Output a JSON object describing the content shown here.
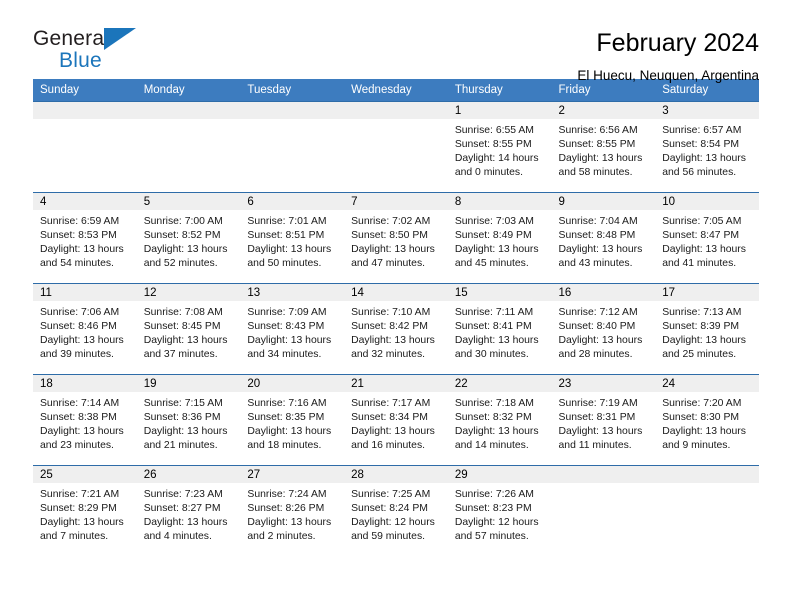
{
  "brand": {
    "name_top": "General",
    "name_bottom": "Blue"
  },
  "header": {
    "title": "February 2024",
    "subtitle": "El Huecu, Neuquen, Argentina"
  },
  "weekday_headers": [
    "Sunday",
    "Monday",
    "Tuesday",
    "Wednesday",
    "Thursday",
    "Friday",
    "Saturday"
  ],
  "colors": {
    "header_blue": "#3d7cbf",
    "row_border": "#2e6ca8",
    "daynum_band": "#efefef",
    "brand_blue": "#1b75bb"
  },
  "weeks": [
    [
      {
        "day": "",
        "empty": true
      },
      {
        "day": "",
        "empty": true
      },
      {
        "day": "",
        "empty": true
      },
      {
        "day": "",
        "empty": true
      },
      {
        "day": "1",
        "sunrise": "Sunrise: 6:55 AM",
        "sunset": "Sunset: 8:55 PM",
        "daylight1": "Daylight: 14 hours",
        "daylight2": "and 0 minutes."
      },
      {
        "day": "2",
        "sunrise": "Sunrise: 6:56 AM",
        "sunset": "Sunset: 8:55 PM",
        "daylight1": "Daylight: 13 hours",
        "daylight2": "and 58 minutes."
      },
      {
        "day": "3",
        "sunrise": "Sunrise: 6:57 AM",
        "sunset": "Sunset: 8:54 PM",
        "daylight1": "Daylight: 13 hours",
        "daylight2": "and 56 minutes."
      }
    ],
    [
      {
        "day": "4",
        "sunrise": "Sunrise: 6:59 AM",
        "sunset": "Sunset: 8:53 PM",
        "daylight1": "Daylight: 13 hours",
        "daylight2": "and 54 minutes."
      },
      {
        "day": "5",
        "sunrise": "Sunrise: 7:00 AM",
        "sunset": "Sunset: 8:52 PM",
        "daylight1": "Daylight: 13 hours",
        "daylight2": "and 52 minutes."
      },
      {
        "day": "6",
        "sunrise": "Sunrise: 7:01 AM",
        "sunset": "Sunset: 8:51 PM",
        "daylight1": "Daylight: 13 hours",
        "daylight2": "and 50 minutes."
      },
      {
        "day": "7",
        "sunrise": "Sunrise: 7:02 AM",
        "sunset": "Sunset: 8:50 PM",
        "daylight1": "Daylight: 13 hours",
        "daylight2": "and 47 minutes."
      },
      {
        "day": "8",
        "sunrise": "Sunrise: 7:03 AM",
        "sunset": "Sunset: 8:49 PM",
        "daylight1": "Daylight: 13 hours",
        "daylight2": "and 45 minutes."
      },
      {
        "day": "9",
        "sunrise": "Sunrise: 7:04 AM",
        "sunset": "Sunset: 8:48 PM",
        "daylight1": "Daylight: 13 hours",
        "daylight2": "and 43 minutes."
      },
      {
        "day": "10",
        "sunrise": "Sunrise: 7:05 AM",
        "sunset": "Sunset: 8:47 PM",
        "daylight1": "Daylight: 13 hours",
        "daylight2": "and 41 minutes."
      }
    ],
    [
      {
        "day": "11",
        "sunrise": "Sunrise: 7:06 AM",
        "sunset": "Sunset: 8:46 PM",
        "daylight1": "Daylight: 13 hours",
        "daylight2": "and 39 minutes."
      },
      {
        "day": "12",
        "sunrise": "Sunrise: 7:08 AM",
        "sunset": "Sunset: 8:45 PM",
        "daylight1": "Daylight: 13 hours",
        "daylight2": "and 37 minutes."
      },
      {
        "day": "13",
        "sunrise": "Sunrise: 7:09 AM",
        "sunset": "Sunset: 8:43 PM",
        "daylight1": "Daylight: 13 hours",
        "daylight2": "and 34 minutes."
      },
      {
        "day": "14",
        "sunrise": "Sunrise: 7:10 AM",
        "sunset": "Sunset: 8:42 PM",
        "daylight1": "Daylight: 13 hours",
        "daylight2": "and 32 minutes."
      },
      {
        "day": "15",
        "sunrise": "Sunrise: 7:11 AM",
        "sunset": "Sunset: 8:41 PM",
        "daylight1": "Daylight: 13 hours",
        "daylight2": "and 30 minutes."
      },
      {
        "day": "16",
        "sunrise": "Sunrise: 7:12 AM",
        "sunset": "Sunset: 8:40 PM",
        "daylight1": "Daylight: 13 hours",
        "daylight2": "and 28 minutes."
      },
      {
        "day": "17",
        "sunrise": "Sunrise: 7:13 AM",
        "sunset": "Sunset: 8:39 PM",
        "daylight1": "Daylight: 13 hours",
        "daylight2": "and 25 minutes."
      }
    ],
    [
      {
        "day": "18",
        "sunrise": "Sunrise: 7:14 AM",
        "sunset": "Sunset: 8:38 PM",
        "daylight1": "Daylight: 13 hours",
        "daylight2": "and 23 minutes."
      },
      {
        "day": "19",
        "sunrise": "Sunrise: 7:15 AM",
        "sunset": "Sunset: 8:36 PM",
        "daylight1": "Daylight: 13 hours",
        "daylight2": "and 21 minutes."
      },
      {
        "day": "20",
        "sunrise": "Sunrise: 7:16 AM",
        "sunset": "Sunset: 8:35 PM",
        "daylight1": "Daylight: 13 hours",
        "daylight2": "and 18 minutes."
      },
      {
        "day": "21",
        "sunrise": "Sunrise: 7:17 AM",
        "sunset": "Sunset: 8:34 PM",
        "daylight1": "Daylight: 13 hours",
        "daylight2": "and 16 minutes."
      },
      {
        "day": "22",
        "sunrise": "Sunrise: 7:18 AM",
        "sunset": "Sunset: 8:32 PM",
        "daylight1": "Daylight: 13 hours",
        "daylight2": "and 14 minutes."
      },
      {
        "day": "23",
        "sunrise": "Sunrise: 7:19 AM",
        "sunset": "Sunset: 8:31 PM",
        "daylight1": "Daylight: 13 hours",
        "daylight2": "and 11 minutes."
      },
      {
        "day": "24",
        "sunrise": "Sunrise: 7:20 AM",
        "sunset": "Sunset: 8:30 PM",
        "daylight1": "Daylight: 13 hours",
        "daylight2": "and 9 minutes."
      }
    ],
    [
      {
        "day": "25",
        "sunrise": "Sunrise: 7:21 AM",
        "sunset": "Sunset: 8:29 PM",
        "daylight1": "Daylight: 13 hours",
        "daylight2": "and 7 minutes."
      },
      {
        "day": "26",
        "sunrise": "Sunrise: 7:23 AM",
        "sunset": "Sunset: 8:27 PM",
        "daylight1": "Daylight: 13 hours",
        "daylight2": "and 4 minutes."
      },
      {
        "day": "27",
        "sunrise": "Sunrise: 7:24 AM",
        "sunset": "Sunset: 8:26 PM",
        "daylight1": "Daylight: 13 hours",
        "daylight2": "and 2 minutes."
      },
      {
        "day": "28",
        "sunrise": "Sunrise: 7:25 AM",
        "sunset": "Sunset: 8:24 PM",
        "daylight1": "Daylight: 12 hours",
        "daylight2": "and 59 minutes."
      },
      {
        "day": "29",
        "sunrise": "Sunrise: 7:26 AM",
        "sunset": "Sunset: 8:23 PM",
        "daylight1": "Daylight: 12 hours",
        "daylight2": "and 57 minutes."
      },
      {
        "day": "",
        "empty": true
      },
      {
        "day": "",
        "empty": true
      }
    ]
  ]
}
